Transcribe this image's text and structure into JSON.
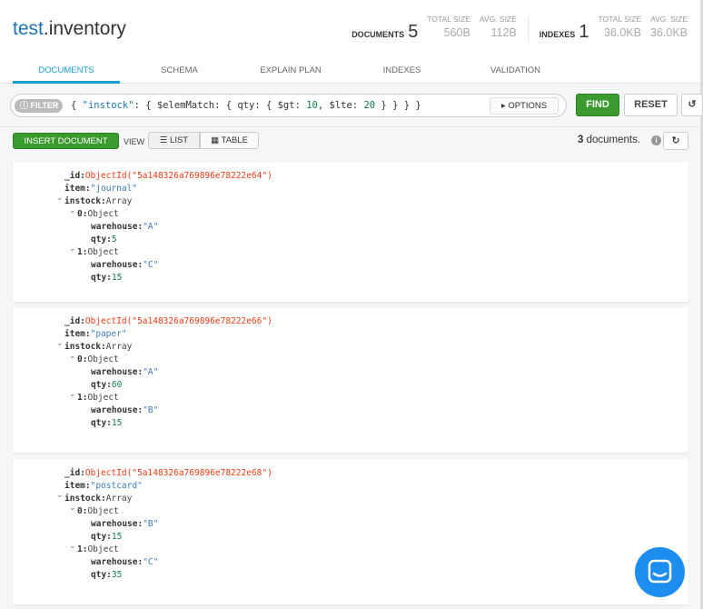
{
  "header": {
    "db": "test",
    "collection": ".inventory",
    "documents_label": "DOCUMENTS",
    "documents_count": "5",
    "doc_total_size_label": "TOTAL SIZE",
    "doc_total_size": "560B",
    "doc_avg_size_label": "AVG. SIZE",
    "doc_avg_size": "112B",
    "indexes_label": "INDEXES",
    "indexes_count": "1",
    "idx_total_size_label": "TOTAL SIZE",
    "idx_total_size": "36.0KB",
    "idx_avg_size_label": "AVG. SIZE",
    "idx_avg_size": "36.0KB"
  },
  "tabs": [
    {
      "label": "DOCUMENTS",
      "active": true
    },
    {
      "label": "SCHEMA"
    },
    {
      "label": "EXPLAIN PLAN"
    },
    {
      "label": "INDEXES"
    },
    {
      "label": "VALIDATION"
    }
  ],
  "query": {
    "filter_label": "FILTER",
    "p1": "{ ",
    "p2": "\"instock\"",
    "p3": ": { $elemMatch: { qty: { $gt: ",
    "p4": "10",
    "p5": ", $lte: ",
    "p6": "20",
    "p7": " } } } }",
    "options_label": "OPTIONS",
    "find_label": "FIND",
    "reset_label": "RESET"
  },
  "toolbar": {
    "insert_label": "INSERT DOCUMENT",
    "view_label": "VIEW",
    "list_label": "LIST",
    "table_label": "TABLE",
    "count": "3",
    "count_suffix": " documents."
  },
  "documents": [
    {
      "id": "ObjectId(\"5a148326a769896e78222e64\")",
      "item": "\"journal\"",
      "instock": [
        {
          "warehouse": "\"A\"",
          "qty": "5"
        },
        {
          "warehouse": "\"C\"",
          "qty": "15"
        }
      ]
    },
    {
      "id": "ObjectId(\"5a148326a769896e78222e66\")",
      "item": "\"paper\"",
      "instock": [
        {
          "warehouse": "\"A\"",
          "qty": "60"
        },
        {
          "warehouse": "\"B\"",
          "qty": "15"
        }
      ]
    },
    {
      "id": "ObjectId(\"5a148326a769896e78222e68\")",
      "item": "\"postcard\"",
      "instock": [
        {
          "warehouse": "\"B\"",
          "qty": "15"
        },
        {
          "warehouse": "\"C\"",
          "qty": "35"
        }
      ]
    }
  ],
  "labels": {
    "id": "_id:",
    "item": "item:",
    "instock": "instock:",
    "array": "Array",
    "object": "Object",
    "warehouse": "warehouse:",
    "qty": "qty:",
    "i0": "0:",
    "i1": "1:"
  },
  "colors": {
    "accent": "#1a9fd9",
    "find": "#3a9a2d",
    "objectid": "#f03c15",
    "string": "#3c7ab8",
    "number": "#128049"
  }
}
